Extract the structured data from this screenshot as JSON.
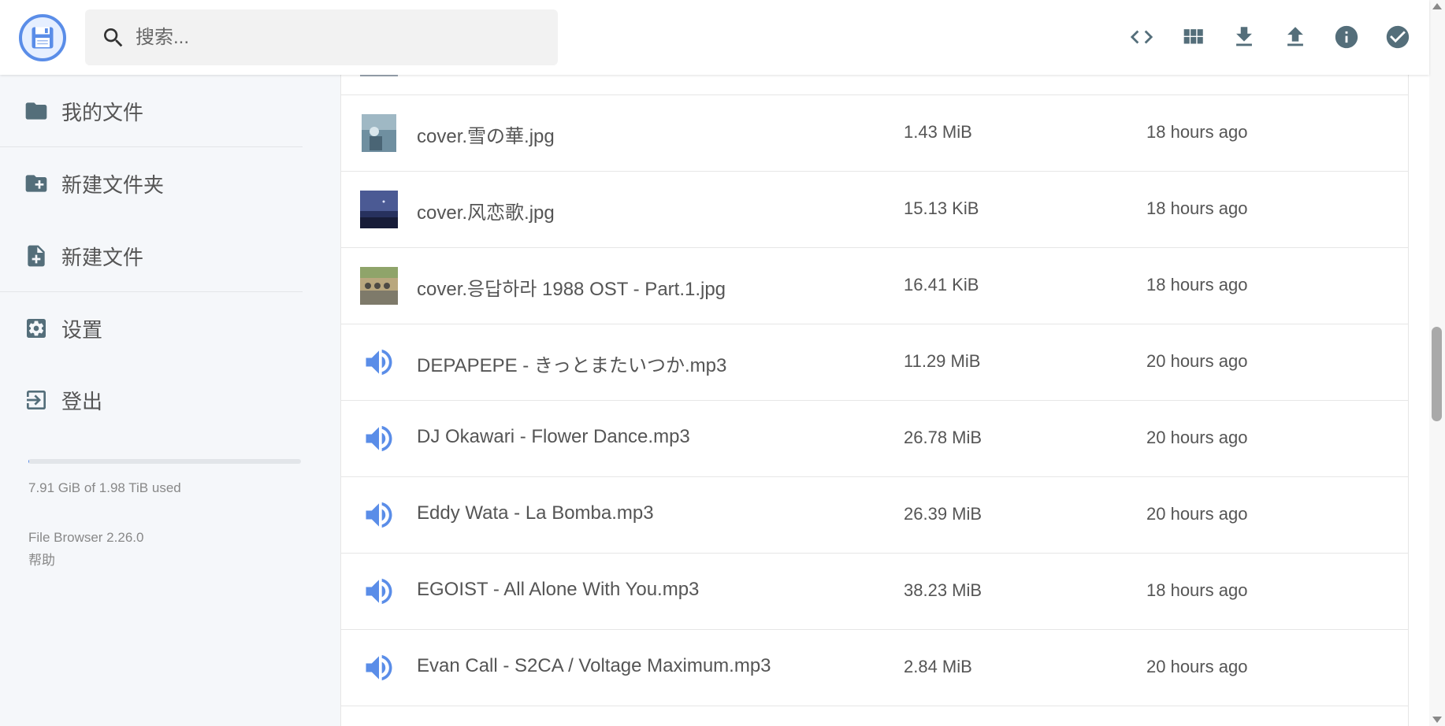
{
  "header": {
    "search": {
      "placeholder": "搜索..."
    },
    "actions": [
      {
        "name": "embed-code",
        "icon": "code-icon"
      },
      {
        "name": "toggle-view",
        "icon": "grid-view-icon"
      },
      {
        "name": "download",
        "icon": "download-icon"
      },
      {
        "name": "upload",
        "icon": "upload-icon"
      },
      {
        "name": "info",
        "icon": "info-icon"
      },
      {
        "name": "select",
        "icon": "check-circle-icon"
      }
    ]
  },
  "sidebar": {
    "items": [
      {
        "label": "我的文件",
        "icon": "folder-icon"
      },
      {
        "label": "新建文件夹",
        "icon": "folder-plus-icon"
      },
      {
        "label": "新建文件",
        "icon": "file-plus-icon"
      },
      {
        "label": "设置",
        "icon": "settings-icon"
      },
      {
        "label": "登出",
        "icon": "logout-icon"
      }
    ],
    "usage": {
      "text": "7.91 GiB of 1.98 TiB used",
      "fraction": 0.0039
    },
    "version": "File Browser 2.26.0",
    "help": "帮助"
  },
  "files": [
    {
      "name": "cover.雪の華.jpg",
      "size": "1.43 MiB",
      "modified": "18 hours ago",
      "kind": "image"
    },
    {
      "name": "cover.风恋歌.jpg",
      "size": "15.13 KiB",
      "modified": "18 hours ago",
      "kind": "image"
    },
    {
      "name": "cover.응답하라 1988 OST - Part.1.jpg",
      "size": "16.41 KiB",
      "modified": "18 hours ago",
      "kind": "image"
    },
    {
      "name": "DEPAPEPE - きっとまたいつか.mp3",
      "size": "11.29 MiB",
      "modified": "20 hours ago",
      "kind": "audio"
    },
    {
      "name": "DJ Okawari - Flower Dance.mp3",
      "size": "26.78 MiB",
      "modified": "20 hours ago",
      "kind": "audio"
    },
    {
      "name": "Eddy Wata - La Bomba.mp3",
      "size": "26.39 MiB",
      "modified": "20 hours ago",
      "kind": "audio"
    },
    {
      "name": "EGOIST - All Alone With You.mp3",
      "size": "38.23 MiB",
      "modified": "18 hours ago",
      "kind": "audio"
    },
    {
      "name": "Evan Call - S2CA / Voltage Maximum.mp3",
      "size": "2.84 MiB",
      "modified": "20 hours ago",
      "kind": "audio"
    }
  ],
  "colors": {
    "accent": "#5a8de8",
    "icon": "#546e7a",
    "sidebar_bg": "#f5f7fa"
  }
}
